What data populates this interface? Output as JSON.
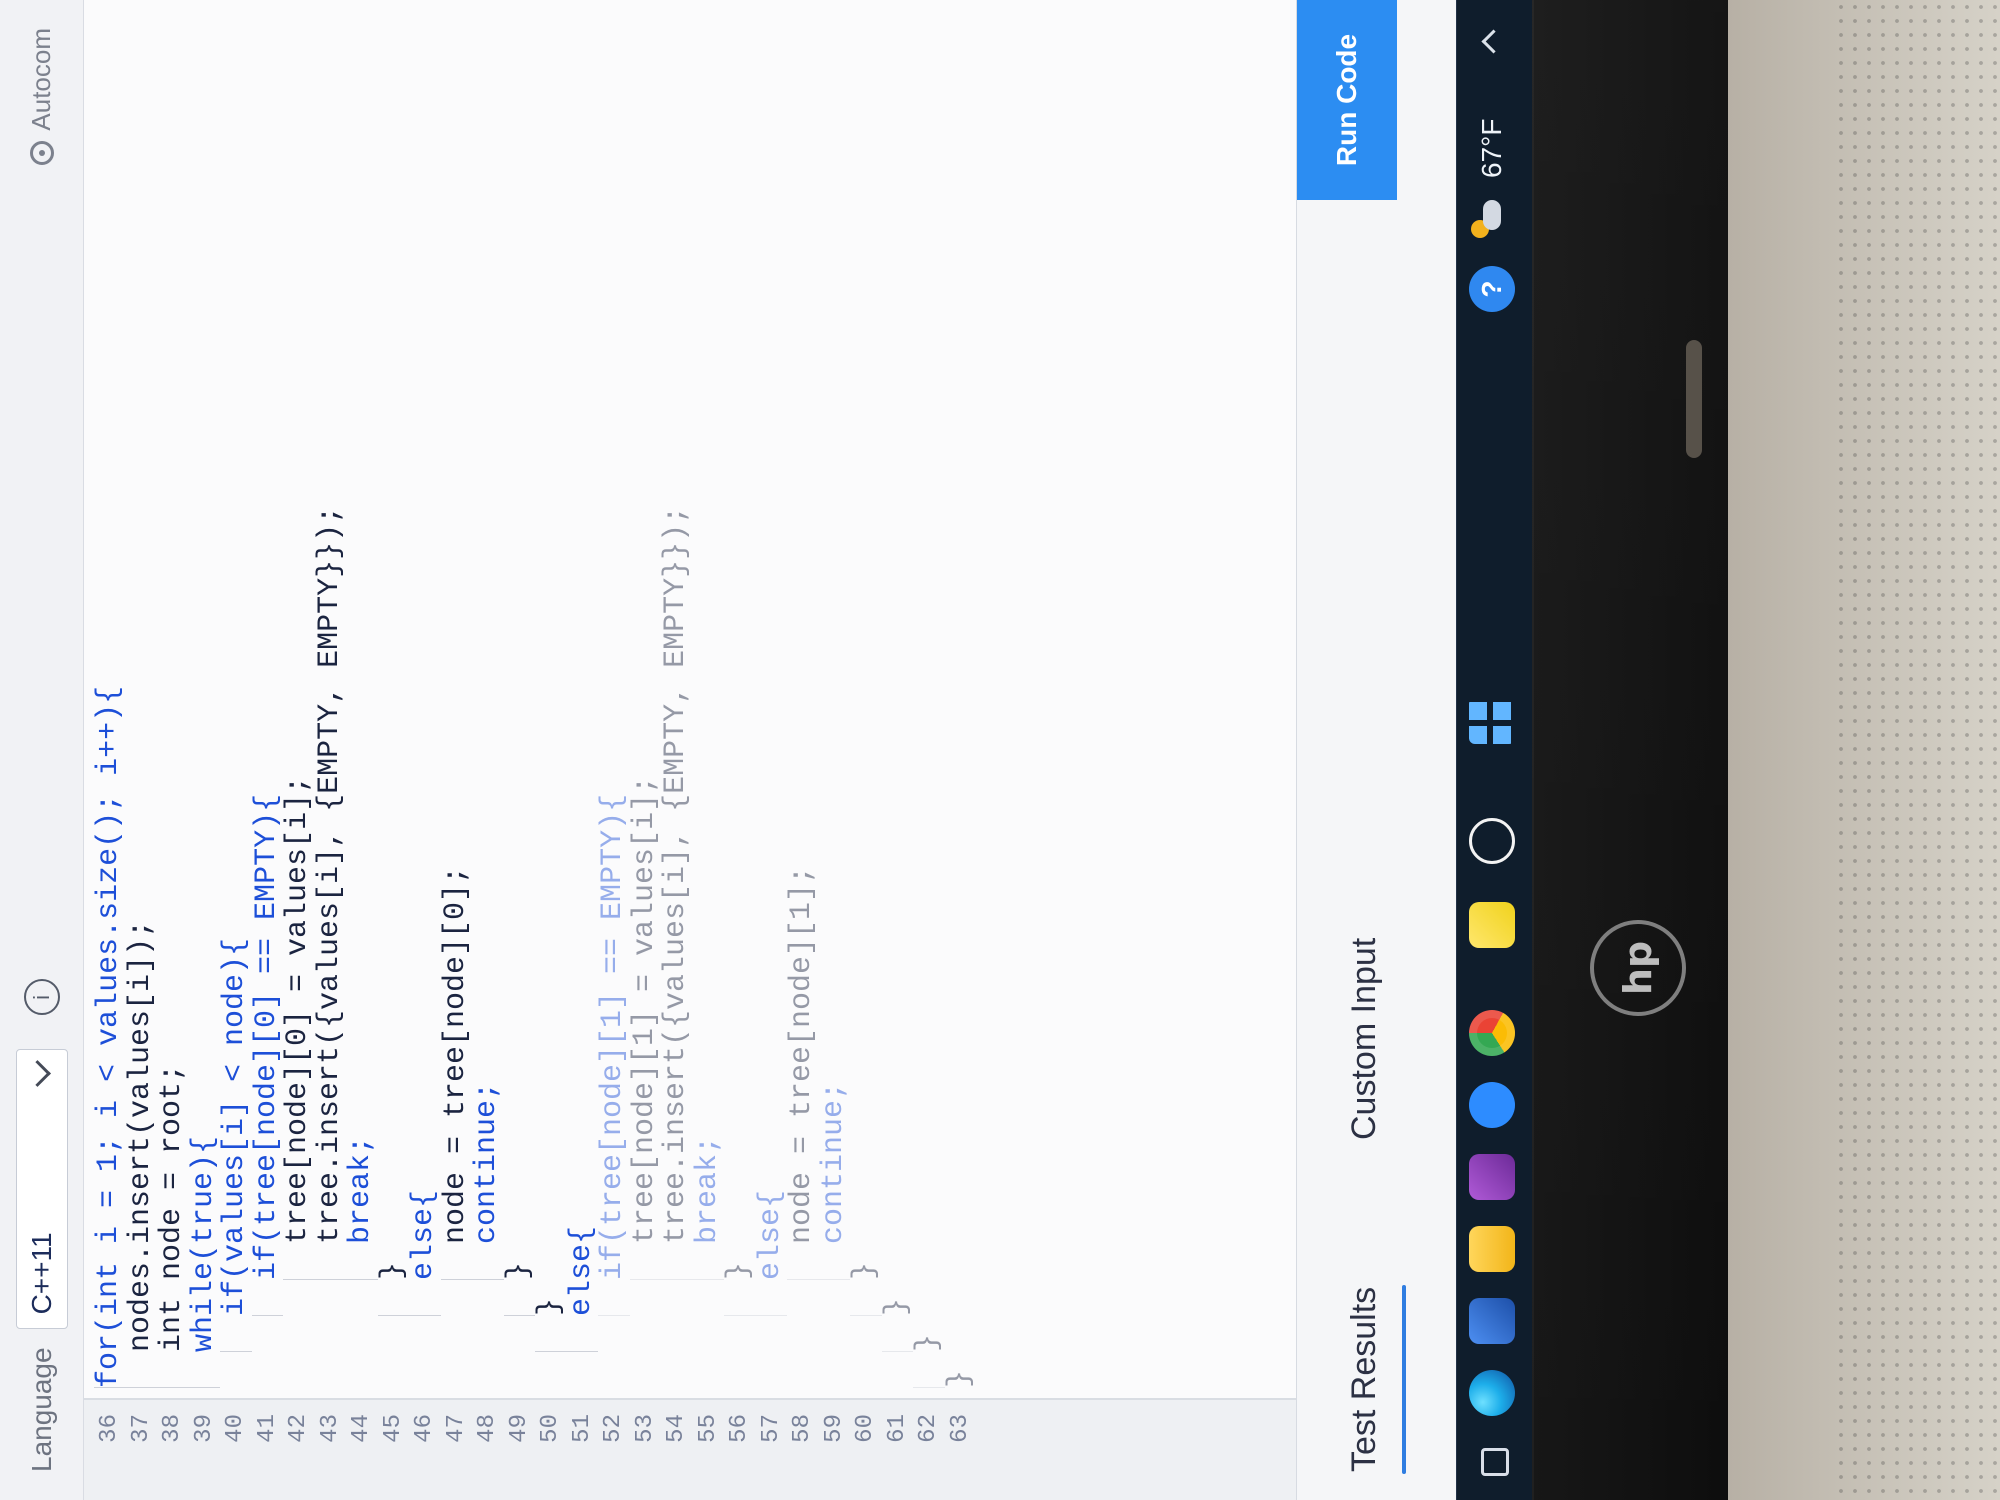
{
  "header": {
    "language_label": "Language",
    "language_value": "C++11",
    "autocomplete_label": "Autocom"
  },
  "editor": {
    "line_numbers": [
      "36",
      "37",
      "38",
      "39",
      "40",
      "41",
      "42",
      "43",
      "44",
      "45",
      "46",
      "47",
      "48",
      "49",
      "50",
      "51",
      "52",
      "53",
      "54",
      "55",
      "56",
      "57",
      "58",
      "59",
      "60",
      "61",
      "62",
      "63"
    ],
    "lines": [
      "for(int i = 1; i < values.size(); i++){",
      "nodes.insert(values[i]);",
      "int node = root;",
      "while(true){",
      "if(values[i] < node){",
      "if(tree[node][0] == EMPTY){",
      "tree[node][0] = values[i];",
      "tree.insert({values[i], {EMPTY, EMPTY}});",
      "break;",
      "}",
      "else{",
      "node = tree[node][0];",
      "continue;",
      "}",
      "}",
      "else{",
      "if(tree[node][1] == EMPTY){",
      "tree[node][1] = values[i];",
      "tree.insert({values[i], {EMPTY, EMPTY}});",
      "break;",
      "}",
      "else{",
      "node = tree[node][1];",
      "continue;",
      "}",
      "}",
      "}",
      "}"
    ]
  },
  "bottom_panel": {
    "tabs": [
      "Test Results",
      "Custom Input"
    ],
    "run_code_label": "Run Code"
  },
  "taskbar": {
    "help_label": "?",
    "temperature": "67°F"
  }
}
